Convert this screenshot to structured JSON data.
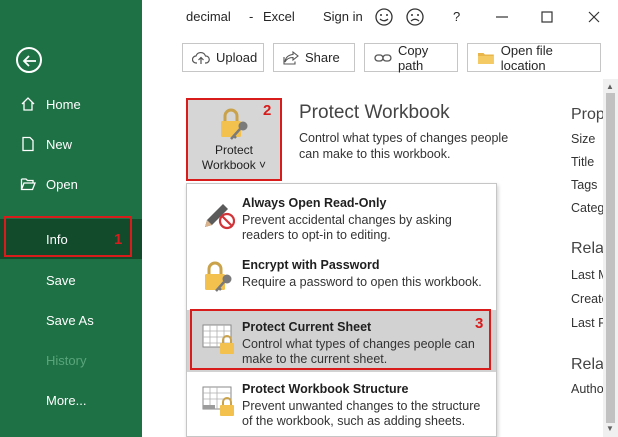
{
  "window": {
    "filename": "decimal",
    "app": "Excel",
    "separator": "-",
    "sign_in": "Sign in",
    "help": "?"
  },
  "sidebar": {
    "items": [
      {
        "label": "Home",
        "icon": "home-icon"
      },
      {
        "label": "New",
        "icon": "new-document-icon"
      },
      {
        "label": "Open",
        "icon": "open-folder-icon"
      },
      {
        "label": "Info"
      },
      {
        "label": "Save"
      },
      {
        "label": "Save As"
      },
      {
        "label": "History"
      },
      {
        "label": "More..."
      }
    ]
  },
  "actions": {
    "upload": "Upload",
    "share": "Share",
    "copy_path": "Copy path",
    "open_location": "Open file location"
  },
  "protect": {
    "button_line1": "Protect",
    "button_line2": "Workbook ˅",
    "title": "Protect Workbook",
    "description": "Control what types of changes people can make to this workbook."
  },
  "properties": {
    "heading": "Prop",
    "items": [
      "Size",
      "Title",
      "Tags",
      "Categ"
    ],
    "related_dates_heading": "Rela",
    "dates": [
      "Last M",
      "Create",
      "Last P"
    ],
    "related_people_heading": "Rela",
    "people": [
      "Autho"
    ]
  },
  "dropdown": {
    "items": [
      {
        "title": "Always Open Read-Only",
        "desc": "Prevent accidental changes by asking readers to opt-in to editing."
      },
      {
        "title": "Encrypt with Password",
        "desc": "Require a password to open this workbook."
      },
      {
        "title": "Protect Current Sheet",
        "desc": "Control what types of changes people can make to the current sheet."
      },
      {
        "title": "Protect Workbook Structure",
        "desc": "Prevent unwanted changes to the structure of the workbook, such as adding sheets."
      }
    ]
  },
  "annotations": {
    "m1": "1",
    "m2": "2",
    "m3": "3"
  },
  "colors": {
    "sidebar": "#1e7145",
    "sidebar_active": "#124a2c",
    "annotation": "#d81b1b"
  }
}
